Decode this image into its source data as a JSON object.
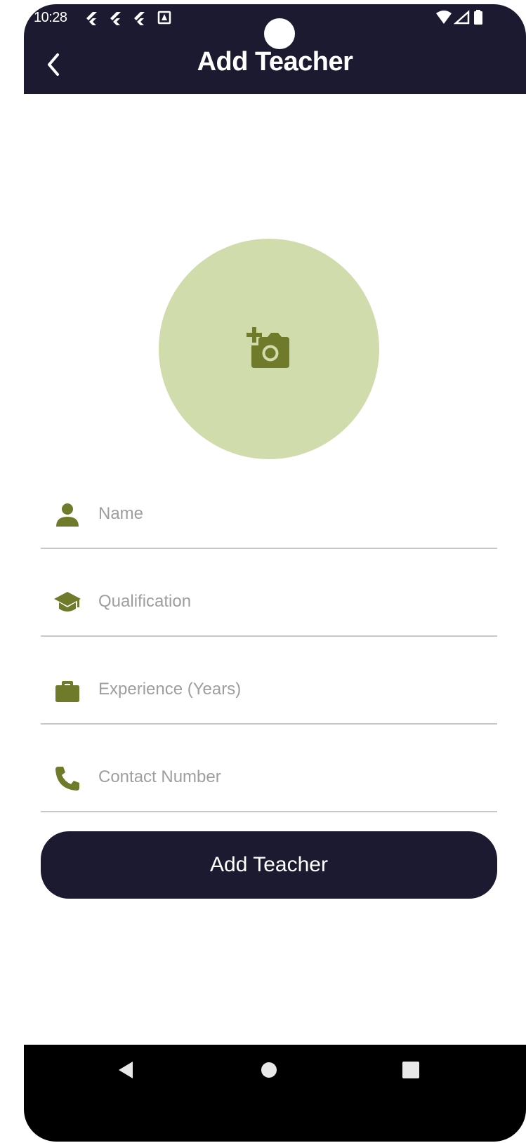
{
  "status_bar": {
    "time": "10:28",
    "left_icons": [
      "flutter-icon",
      "flutter-icon",
      "flutter-icon",
      "notification-a-icon"
    ],
    "right_icons": [
      "wifi-icon",
      "signal-icon",
      "battery-icon"
    ]
  },
  "app_bar": {
    "title": "Add Teacher",
    "back_icon": "chevron-left-icon",
    "background": "#1b1a31"
  },
  "avatar": {
    "icon": "add-a-photo-icon",
    "background": "#d1dcac",
    "icon_color": "#6f7a2b"
  },
  "form": {
    "fields": [
      {
        "icon": "person-icon",
        "placeholder": "Name",
        "value": ""
      },
      {
        "icon": "graduation-cap-icon",
        "placeholder": "Qualification",
        "value": ""
      },
      {
        "icon": "briefcase-icon",
        "placeholder": "Experience (Years)",
        "value": ""
      },
      {
        "icon": "phone-icon",
        "placeholder": "Contact Number",
        "value": ""
      }
    ],
    "submit_label": "Add Teacher"
  },
  "nav_bar": {
    "items": [
      "back-triangle-icon",
      "home-circle-icon",
      "recents-square-icon"
    ]
  },
  "colors": {
    "primary_dark": "#1b1a31",
    "accent_olive": "#6f7a2b",
    "avatar_bg": "#d1dcac",
    "placeholder": "#9e9e9e",
    "divider": "#c8c8c8"
  }
}
